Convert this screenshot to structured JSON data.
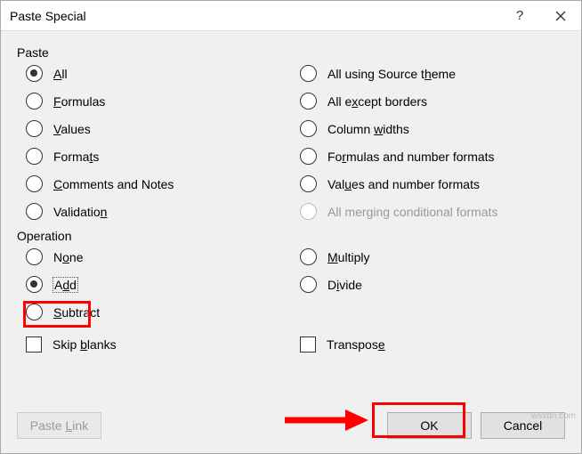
{
  "title": "Paste Special",
  "groups": {
    "paste": {
      "label": "Paste",
      "left": [
        {
          "pre": "",
          "u": "A",
          "post": "ll",
          "checked": true
        },
        {
          "pre": "",
          "u": "F",
          "post": "ormulas",
          "checked": false
        },
        {
          "pre": "",
          "u": "V",
          "post": "alues",
          "checked": false
        },
        {
          "pre": "Forma",
          "u": "t",
          "post": "s",
          "checked": false
        },
        {
          "pre": "",
          "u": "C",
          "post": "omments and Notes",
          "checked": false
        },
        {
          "pre": "Validatio",
          "u": "n",
          "post": "",
          "checked": false
        }
      ],
      "right": [
        {
          "pre": "All using Source t",
          "u": "h",
          "post": "eme",
          "checked": false,
          "disabled": false
        },
        {
          "pre": "All e",
          "u": "x",
          "post": "cept borders",
          "checked": false,
          "disabled": false
        },
        {
          "pre": "Column ",
          "u": "w",
          "post": "idths",
          "checked": false,
          "disabled": false
        },
        {
          "pre": "Fo",
          "u": "r",
          "post": "mulas and number formats",
          "checked": false,
          "disabled": false
        },
        {
          "pre": "Val",
          "u": "u",
          "post": "es and number formats",
          "checked": false,
          "disabled": false
        },
        {
          "pre": "All mer",
          "u": "g",
          "post": "ing conditional formats",
          "checked": false,
          "disabled": true
        }
      ]
    },
    "operation": {
      "label": "Operation",
      "left": [
        {
          "pre": "N",
          "u": "o",
          "post": "ne",
          "checked": false
        },
        {
          "pre": "A",
          "u": "d",
          "post": "d",
          "checked": true,
          "dotted": true
        },
        {
          "pre": "",
          "u": "S",
          "post": "ubtract",
          "checked": false
        }
      ],
      "right": [
        {
          "pre": "",
          "u": "M",
          "post": "ultiply",
          "checked": false
        },
        {
          "pre": "D",
          "u": "i",
          "post": "vide",
          "checked": false
        }
      ]
    }
  },
  "checkboxes": {
    "skip": {
      "pre": "Skip ",
      "u": "b",
      "post": "lanks"
    },
    "transpose": {
      "pre": "Transpos",
      "u": "e",
      "post": ""
    }
  },
  "buttons": {
    "paste_link": {
      "pre": "Paste ",
      "u": "L",
      "post": "ink"
    },
    "ok": "OK",
    "cancel": "Cancel"
  },
  "watermark": "wsxdn.com"
}
